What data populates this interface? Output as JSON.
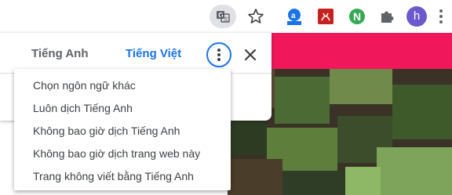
{
  "toolbar": {
    "avatar_letter": "h",
    "icons": [
      "translate-icon",
      "star-icon",
      "amazon-assistant-icon",
      "pdf-icon",
      "n-extension-icon",
      "puzzle-icon",
      "profile-avatar",
      "more-vert-icon"
    ]
  },
  "translate_bubble": {
    "tabs": [
      {
        "label": "Tiếng Anh",
        "selected": false
      },
      {
        "label": "Tiếng Việt",
        "selected": true
      }
    ],
    "accent_color": "#1a73e8"
  },
  "options_menu": {
    "items": [
      {
        "label": "Chọn ngôn ngữ khác"
      },
      {
        "label": "Luôn dịch Tiếng Anh"
      },
      {
        "label": "Không bao giờ dịch Tiếng Anh"
      },
      {
        "label": "Không bao giờ dịch trang web này"
      },
      {
        "label": "Trang không viết bằng Tiếng Anh"
      }
    ]
  },
  "colors": {
    "page_banner": "#f0175a",
    "pdf_red": "#c5221f",
    "n_green": "#34a853",
    "avatar_purple": "#6a5acd"
  }
}
